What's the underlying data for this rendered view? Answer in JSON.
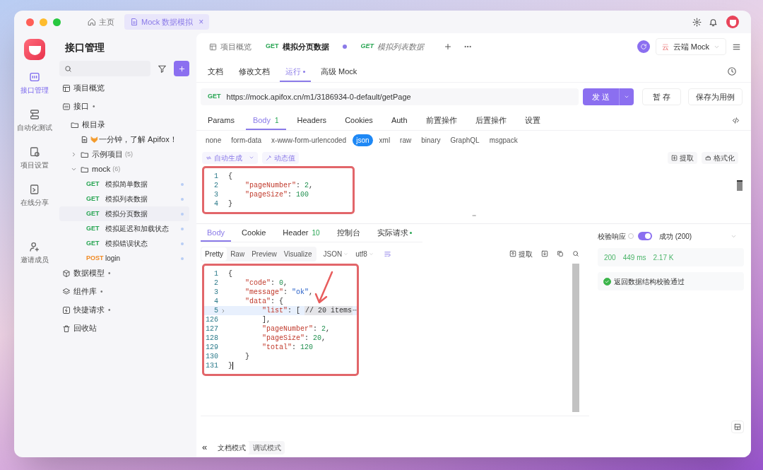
{
  "titlebar": {
    "tabs": [
      {
        "label": "主页",
        "selected": false
      },
      {
        "label": "Mock 数据模拟",
        "selected": true,
        "closable": "×"
      }
    ]
  },
  "rail": {
    "items": [
      {
        "label": "接口管理",
        "selected": true
      },
      {
        "label": "自动化测试",
        "selected": false
      },
      {
        "label": "项目设置",
        "selected": false
      },
      {
        "label": "在线分享",
        "selected": false
      },
      {
        "label": "邀请成员",
        "selected": false
      }
    ]
  },
  "sidebar": {
    "title": "接口管理",
    "items": [
      {
        "kind": "node",
        "label": "项目概览"
      },
      {
        "kind": "node",
        "label": "接口",
        "marker": "•",
        "children": [
          {
            "kind": "folder",
            "label": "根目录",
            "children": [
              {
                "kind": "doc",
                "label": "一分钟，了解 Apifox！"
              },
              {
                "kind": "folder",
                "label": "示例项目",
                "count": "(5)",
                "expanded": false
              },
              {
                "kind": "folder",
                "label": "mock",
                "count": "(6)",
                "expanded": true,
                "children": [
                  {
                    "kind": "endpoint",
                    "method": "GET",
                    "label": "模拟简单数据",
                    "selected": false
                  },
                  {
                    "kind": "endpoint",
                    "method": "GET",
                    "label": "模拟列表数据",
                    "selected": false
                  },
                  {
                    "kind": "endpoint",
                    "method": "GET",
                    "label": "模拟分页数据",
                    "selected": true
                  },
                  {
                    "kind": "endpoint",
                    "method": "GET",
                    "label": "模拟延迟和加载状态",
                    "selected": false
                  },
                  {
                    "kind": "endpoint",
                    "method": "GET",
                    "label": "模拟错误状态",
                    "selected": false
                  },
                  {
                    "kind": "endpoint",
                    "method": "POST",
                    "label": "login",
                    "selected": false
                  }
                ]
              }
            ]
          }
        ]
      },
      {
        "kind": "node",
        "label": "数据模型",
        "marker": "•"
      },
      {
        "kind": "node",
        "label": "组件库",
        "marker": "•"
      },
      {
        "kind": "node",
        "label": "快捷请求",
        "marker": "•"
      },
      {
        "kind": "node",
        "label": "回收站"
      }
    ]
  },
  "main_tabs": [
    {
      "kind": "overview",
      "label": "项目概览",
      "selected": false
    },
    {
      "kind": "endpoint",
      "method": "GET",
      "label": "模拟分页数据",
      "selected": true,
      "unsaved": true,
      "preview": false
    },
    {
      "kind": "endpoint",
      "method": "GET",
      "label": "模拟列表数据",
      "selected": false,
      "unsaved": false,
      "preview": true
    }
  ],
  "environment": {
    "badge": "云",
    "label": "云端 Mock"
  },
  "sub_tabs": [
    {
      "label": "文档",
      "selected": false,
      "dot": false
    },
    {
      "label": "修改文档",
      "selected": false,
      "dot": false
    },
    {
      "label": "运行",
      "selected": true,
      "dot": true
    },
    {
      "label": "高级 Mock",
      "selected": false,
      "dot": false
    }
  ],
  "request": {
    "method": "GET",
    "url": "https://mock.apifox.cn/m1/3186934-0-default/getPage",
    "send": "发 送",
    "save": "暂 存",
    "save_case": "保存为用例"
  },
  "request_tabs": [
    {
      "label": "Params",
      "selected": false
    },
    {
      "label": "Body",
      "count": "1",
      "selected": true
    },
    {
      "label": "Headers",
      "selected": false
    },
    {
      "label": "Cookies",
      "selected": false
    },
    {
      "label": "Auth",
      "selected": false
    },
    {
      "label": "前置操作",
      "selected": false
    },
    {
      "label": "后置操作",
      "selected": false
    },
    {
      "label": "设置",
      "selected": false
    }
  ],
  "body_types": [
    {
      "label": "none",
      "selected": false
    },
    {
      "label": "form-data",
      "selected": false
    },
    {
      "label": "x-www-form-urlencoded",
      "selected": false
    },
    {
      "label": "json",
      "selected": true
    },
    {
      "label": "xml",
      "selected": false
    },
    {
      "label": "raw",
      "selected": false
    },
    {
      "label": "binary",
      "selected": false
    },
    {
      "label": "GraphQL",
      "selected": false
    },
    {
      "label": "msgpack",
      "selected": false
    }
  ],
  "body_tools": {
    "left": [
      "自动生成",
      "动态值"
    ],
    "right": [
      "提取",
      "格式化"
    ]
  },
  "request_body": {
    "outlined": true,
    "lines": [
      {
        "number": "1",
        "text": "{"
      },
      {
        "number": "2",
        "text": "    \"pageNumber\": 2,"
      },
      {
        "number": "3",
        "text": "    \"pageSize\": 100"
      },
      {
        "number": "4",
        "text": "}"
      }
    ]
  },
  "response_tabs": [
    {
      "label": "Body",
      "selected": true
    },
    {
      "label": "Cookie",
      "selected": false
    },
    {
      "label": "Header",
      "count": "10",
      "selected": false
    },
    {
      "label": "控制台",
      "selected": false
    },
    {
      "label": "实际请求",
      "selected": false,
      "dot": true
    }
  ],
  "view_modes": [
    {
      "label": "Pretty",
      "selected": true
    },
    {
      "label": "Raw",
      "selected": false
    },
    {
      "label": "Preview",
      "selected": false
    },
    {
      "label": "Visualize",
      "selected": false
    }
  ],
  "format_selects": [
    "JSON",
    "utf8"
  ],
  "wrap_on": true,
  "response_extract": "提取",
  "response_body": {
    "outlined": true,
    "arrow": true,
    "lines": [
      {
        "number": "1",
        "text": "{"
      },
      {
        "number": "2",
        "text": "    \"code\": 0,"
      },
      {
        "number": "3",
        "text": "    \"message\": \"ok\","
      },
      {
        "number": "4",
        "text": "    \"data\": {"
      },
      {
        "number": "5",
        "text": "        \"list\": [ ",
        "folded": true,
        "fold_summary": "// 20 items",
        "fold_more": "⋯",
        "highlighted": true
      },
      {
        "number": "126",
        "text": "        ],"
      },
      {
        "number": "127",
        "text": "        \"pageNumber\": 2,"
      },
      {
        "number": "128",
        "text": "        \"pageSize\": 20,"
      },
      {
        "number": "129",
        "text": "        \"total\": 120"
      },
      {
        "number": "130",
        "text": "    }"
      },
      {
        "number": "131",
        "text": "}",
        "cursor": true
      }
    ]
  },
  "validation": {
    "label": "校验响应",
    "on": true,
    "result": "成功 (200)",
    "stats": [
      "200",
      "449 ms",
      "2.17 K"
    ],
    "message": "返回数据结构校验通过",
    "passed": true
  },
  "footer": {
    "collapse": "«",
    "modes": [
      {
        "label": "文档模式",
        "selected": true
      },
      {
        "label": "调试模式",
        "selected": false
      }
    ]
  }
}
